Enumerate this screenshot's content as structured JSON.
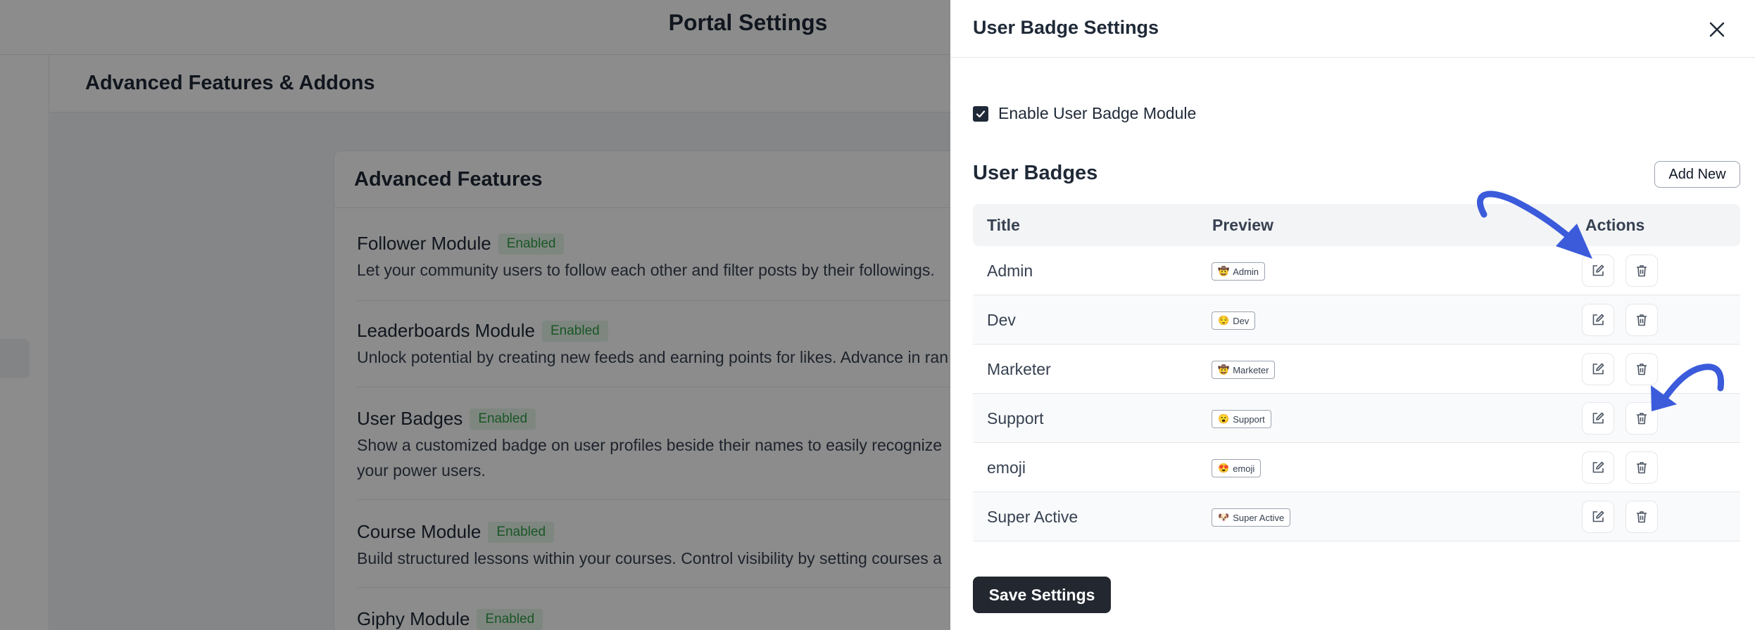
{
  "portal": {
    "title": "Portal Settings"
  },
  "section": {
    "title": "Advanced Features & Addons"
  },
  "card": {
    "title": "Advanced Features",
    "features": [
      {
        "name": "Follower Module",
        "status": "Enabled",
        "desc1": "Let your community users to follow each other and filter posts by their followings.",
        "desc2": ""
      },
      {
        "name": "Leaderboards Module",
        "status": "Enabled",
        "desc1": "Unlock potential by creating new feeds and earning points for likes. Advance in ran",
        "desc2": ""
      },
      {
        "name": "User Badges",
        "status": "Enabled",
        "desc1": "Show a customized badge on user profiles beside their names to easily recognize",
        "desc2": "your power users."
      },
      {
        "name": "Course Module",
        "status": "Enabled",
        "desc1": "Build structured lessons within your courses. Control visibility by setting courses a",
        "desc2": ""
      },
      {
        "name": "Giphy Module",
        "status": "Enabled",
        "desc1": "",
        "desc2": ""
      }
    ]
  },
  "drawer": {
    "title": "User Badge Settings",
    "enable_label": "Enable User Badge Module",
    "badges_title": "User Badges",
    "add_new_label": "Add New",
    "columns": {
      "title": "Title",
      "preview": "Preview",
      "actions": "Actions"
    },
    "rows": [
      {
        "title": "Admin",
        "emoji": "🤠",
        "label": "Admin"
      },
      {
        "title": "Dev",
        "emoji": "😌",
        "label": "Dev"
      },
      {
        "title": "Marketer",
        "emoji": "🤠",
        "label": "Marketer"
      },
      {
        "title": "Support",
        "emoji": "😮",
        "label": "Support"
      },
      {
        "title": "emoji",
        "emoji": "😍",
        "label": "emoji"
      },
      {
        "title": "Super Active",
        "emoji": "🐶",
        "label": "Super Active"
      }
    ],
    "save_label": "Save Settings"
  },
  "icons": {
    "close": "close-icon",
    "checkbox": "check-icon",
    "edit": "edit-icon",
    "delete": "trash-icon",
    "annotation": "arrow-annotation-icon"
  },
  "colors": {
    "primary_dark": "#23272f",
    "enabled_bg": "#e6f4ea",
    "enabled_text": "#2f9e44",
    "annotation_arrow": "#3b5bdb"
  }
}
